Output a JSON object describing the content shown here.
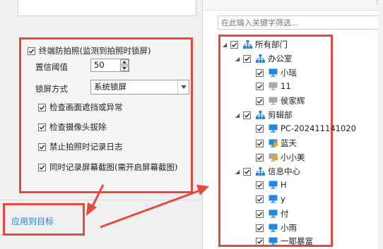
{
  "settings": {
    "main_option": {
      "label": "终端防拍照(监测到拍照时锁屏)",
      "checked": true
    },
    "threshold": {
      "label": "置信阈值",
      "value": "50"
    },
    "lock_mode": {
      "label": "锁屏方式",
      "value": "系统锁屏"
    },
    "options": [
      {
        "label": "检查画面遮挡或异常",
        "checked": true
      },
      {
        "label": "检查摄像头拔除",
        "checked": true
      },
      {
        "label": "禁止拍照时记录日志",
        "checked": true
      },
      {
        "label": "同时记录屏幕截图(需开启屏幕截图)",
        "checked": true
      }
    ]
  },
  "apply": {
    "label": "应用到目标"
  },
  "search": {
    "placeholder": "在此输入关键字筛选..."
  },
  "tree": {
    "root": {
      "label": "所有部门"
    },
    "groups": [
      {
        "label": "办公室",
        "children": [
          {
            "label": "小瑶",
            "status": "online"
          },
          {
            "label": "11",
            "status": "offline"
          },
          {
            "label": "侯家辉",
            "status": "offline"
          }
        ]
      },
      {
        "label": "剪辑部",
        "children": [
          {
            "label": "PC-202411141020",
            "status": "online"
          },
          {
            "label": "蓝天",
            "status": "locked"
          },
          {
            "label": "小小美",
            "status": "locked-offline"
          }
        ]
      },
      {
        "label": "信息中心",
        "children": [
          {
            "label": "H",
            "status": "online"
          },
          {
            "label": "y",
            "status": "online"
          },
          {
            "label": "付",
            "status": "online"
          },
          {
            "label": "小雨",
            "status": "online"
          },
          {
            "label": "一耶暴富",
            "status": "online"
          }
        ]
      }
    ]
  },
  "colors": {
    "highlight_border": "#e8473b",
    "link": "#2e7bd6",
    "computer_online": "#1e88e5",
    "computer_offline": "#a8a8a8",
    "lock_badge": "#f0a020",
    "department_icon": "#2f7fd8"
  }
}
